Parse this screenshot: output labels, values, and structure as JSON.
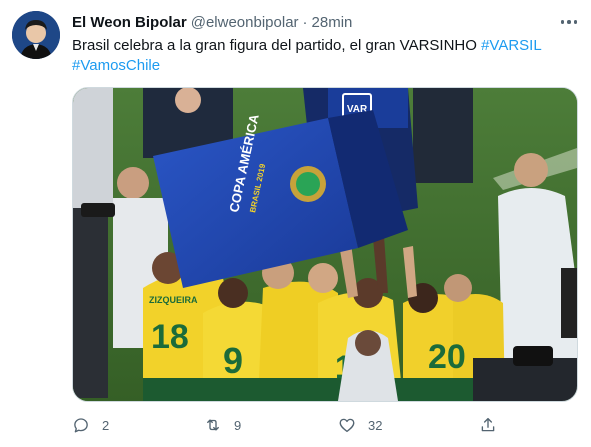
{
  "tweet": {
    "display_name": "El Weon Bipolar",
    "handle": "@elweonbipolar",
    "separator": "·",
    "time": "28min",
    "text_plain": "Brasil celebra a la gran figura del partido, el gran VARSINHO ",
    "hashtag_1": "#VARSIL",
    "hashtag_2": "#VamosChile",
    "actions": {
      "reply_count": "2",
      "retweet_count": "9",
      "like_count": "32"
    }
  },
  "media": {
    "trophy_box_text": "COPA AMÉRICA",
    "trophy_box_subtext": "BRASIL 2019",
    "monitor_text": "VAR",
    "jersey_numbers": [
      "18",
      "9",
      "19",
      "20"
    ],
    "jersey_name": "ZIZQUEIRA"
  },
  "colors": {
    "accent": "#1d9bf0",
    "secondary_text": "#536471",
    "border": "#cfd9de",
    "jersey_yellow": "#f2d22a",
    "box_blue": "#1f3fa3"
  },
  "icons": {
    "more": "more-icon",
    "reply": "reply-icon",
    "retweet": "retweet-icon",
    "like": "like-icon",
    "share": "share-icon"
  }
}
